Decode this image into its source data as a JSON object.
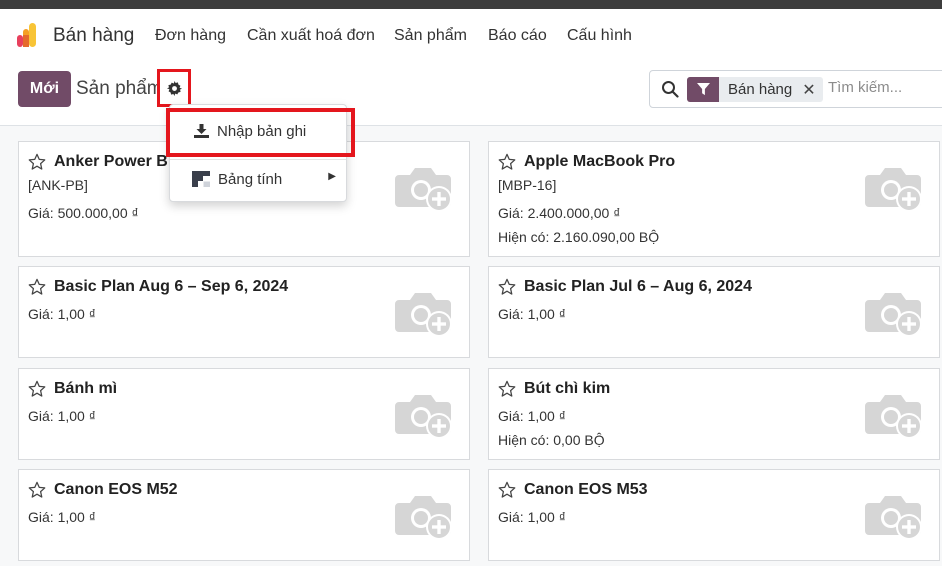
{
  "navbar": {
    "app_title": "Bán hàng",
    "menu": [
      "Đơn hàng",
      "Cần xuất hoá đơn",
      "Sản phẩm",
      "Báo cáo",
      "Cấu hình"
    ]
  },
  "control": {
    "new_button": "Mới",
    "breadcrumb": "Sản phẩm",
    "gear_icon": "gear-icon"
  },
  "search": {
    "facet_label": "Bán hàng",
    "placeholder": "Tìm kiếm..."
  },
  "dropdown": {
    "import_label": "Nhập bản ghi",
    "spreadsheet_label": "Bảng tính"
  },
  "products": [
    {
      "name": "Anker Power B",
      "ref": "[ANK-PB]",
      "price": "Giá: 500.000,00 ₫",
      "onhand": ""
    },
    {
      "name": "Apple MacBook Pro",
      "ref": "[MBP-16]",
      "price": "Giá: 2.400.000,00 ₫",
      "onhand": "Hiện có: 2.160.090,00 BỘ"
    },
    {
      "name": "Basic Plan Aug 6 – Sep 6, 2024",
      "ref": "",
      "price": "Giá: 1,00 ₫",
      "onhand": ""
    },
    {
      "name": "Basic Plan Jul 6 – Aug 6, 2024",
      "ref": "",
      "price": "Giá: 1,00 ₫",
      "onhand": ""
    },
    {
      "name": "Bánh mì",
      "ref": "",
      "price": "Giá: 1,00 ₫",
      "onhand": ""
    },
    {
      "name": "Bút chì kim",
      "ref": "",
      "price": "Giá: 1,00 ₫",
      "onhand": "Hiện có: 0,00 BỘ"
    },
    {
      "name": "Canon EOS M52",
      "ref": "",
      "price": "Giá: 1,00 ₫",
      "onhand": ""
    },
    {
      "name": "Canon EOS M53",
      "ref": "",
      "price": "Giá: 1,00 ₫",
      "onhand": ""
    }
  ],
  "colors": {
    "brand": "#714b67",
    "highlight": "#e4161d"
  }
}
